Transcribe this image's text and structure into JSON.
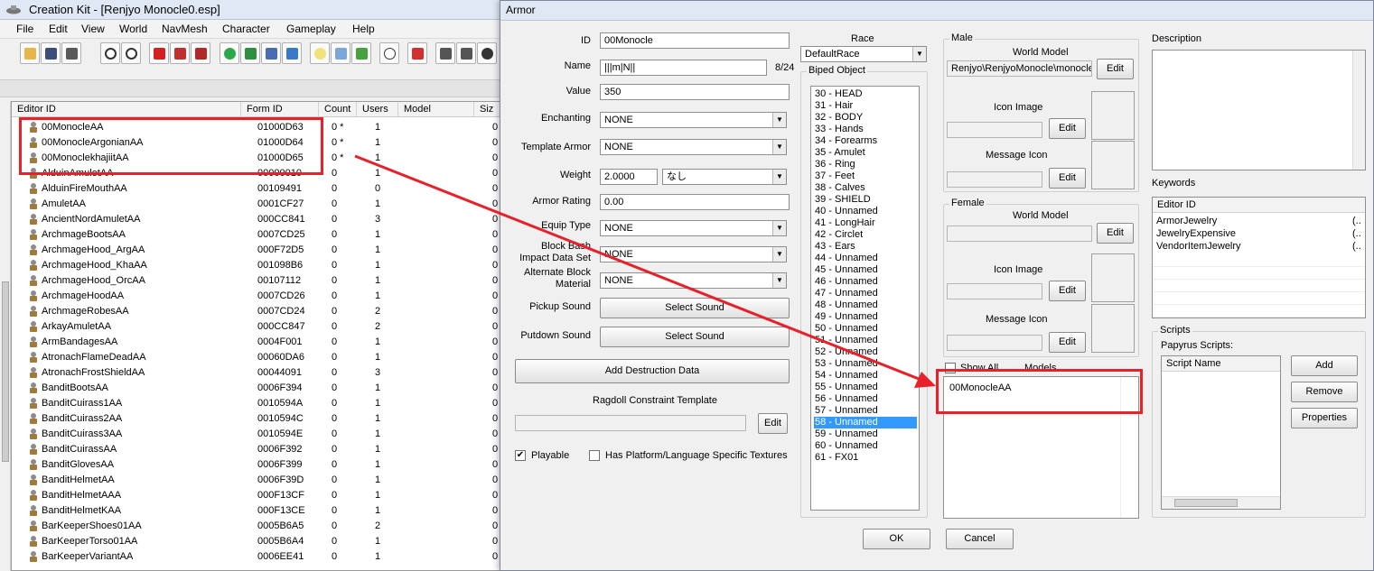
{
  "main_window": {
    "title": "Creation Kit - [Renjyo Monocle0.esp]",
    "menu": [
      "File",
      "Edit",
      "View",
      "World",
      "NavMesh",
      "Character",
      "Gameplay",
      "Help"
    ],
    "toolbar_icons": [
      "open-icon",
      "save-icon",
      "save-all-icon",
      "undo-icon",
      "redo-icon",
      "render-icon",
      "terrain-icon",
      "navmesh-icon",
      "world-icon",
      "landscape-icon",
      "havok-icon",
      "fx-icon",
      "light-icon",
      "sky-icon",
      "grass-icon",
      "dialogue-icon",
      "markers-icon",
      "ref-icon",
      "ref2-icon",
      "mode-icon",
      "collision-icon"
    ]
  },
  "object_list": {
    "columns": [
      "Editor ID",
      "Form ID",
      "Count",
      "Users",
      "Model",
      "Siz"
    ],
    "rows": [
      {
        "id": "00MonocleAA",
        "form": "01000D63",
        "count": "0 *",
        "users": "1",
        "size": "0"
      },
      {
        "id": "00MonocleArgonianAA",
        "form": "01000D64",
        "count": "0 *",
        "users": "1",
        "size": "0"
      },
      {
        "id": "00MonoclekhajiitAA",
        "form": "01000D65",
        "count": "0 *",
        "users": "1",
        "size": "0"
      },
      {
        "id": "AlduinAmuletAA",
        "form": "00000010",
        "count": "0",
        "users": "1",
        "size": "0"
      },
      {
        "id": "AlduinFireMouthAA",
        "form": "00109491",
        "count": "0",
        "users": "0",
        "size": "0"
      },
      {
        "id": "AmuletAA",
        "form": "0001CF27",
        "count": "0",
        "users": "1",
        "size": "0"
      },
      {
        "id": "AncientNordAmuletAA",
        "form": "000CC841",
        "count": "0",
        "users": "3",
        "size": "0"
      },
      {
        "id": "ArchmageBootsAA",
        "form": "0007CD25",
        "count": "0",
        "users": "1",
        "size": "0"
      },
      {
        "id": "ArchmageHood_ArgAA",
        "form": "000F72D5",
        "count": "0",
        "users": "1",
        "size": "0"
      },
      {
        "id": "ArchmageHood_KhaAA",
        "form": "001098B6",
        "count": "0",
        "users": "1",
        "size": "0"
      },
      {
        "id": "ArchmageHood_OrcAA",
        "form": "00107112",
        "count": "0",
        "users": "1",
        "size": "0"
      },
      {
        "id": "ArchmageHoodAA",
        "form": "0007CD26",
        "count": "0",
        "users": "1",
        "size": "0"
      },
      {
        "id": "ArchmageRobesAA",
        "form": "0007CD24",
        "count": "0",
        "users": "2",
        "size": "0"
      },
      {
        "id": "ArkayAmuletAA",
        "form": "000CC847",
        "count": "0",
        "users": "2",
        "size": "0"
      },
      {
        "id": "ArmBandagesAA",
        "form": "0004F001",
        "count": "0",
        "users": "1",
        "size": "0"
      },
      {
        "id": "AtronachFlameDeadAA",
        "form": "00060DA6",
        "count": "0",
        "users": "1",
        "size": "0"
      },
      {
        "id": "AtronachFrostShieldAA",
        "form": "00044091",
        "count": "0",
        "users": "3",
        "size": "0"
      },
      {
        "id": "BanditBootsAA",
        "form": "0006F394",
        "count": "0",
        "users": "1",
        "size": "0"
      },
      {
        "id": "BanditCuirass1AA",
        "form": "0010594A",
        "count": "0",
        "users": "1",
        "size": "0"
      },
      {
        "id": "BanditCuirass2AA",
        "form": "0010594C",
        "count": "0",
        "users": "1",
        "size": "0"
      },
      {
        "id": "BanditCuirass3AA",
        "form": "0010594E",
        "count": "0",
        "users": "1",
        "size": "0"
      },
      {
        "id": "BanditCuirassAA",
        "form": "0006F392",
        "count": "0",
        "users": "1",
        "size": "0"
      },
      {
        "id": "BanditGlovesAA",
        "form": "0006F399",
        "count": "0",
        "users": "1",
        "size": "0"
      },
      {
        "id": "BanditHelmetAA",
        "form": "0006F39D",
        "count": "0",
        "users": "1",
        "size": "0"
      },
      {
        "id": "BanditHelmetAAA",
        "form": "000F13CF",
        "count": "0",
        "users": "1",
        "size": "0"
      },
      {
        "id": "BanditHelmetKAA",
        "form": "000F13CE",
        "count": "0",
        "users": "1",
        "size": "0"
      },
      {
        "id": "BarKeeperShoes01AA",
        "form": "0005B6A5",
        "count": "0",
        "users": "2",
        "size": "0"
      },
      {
        "id": "BarKeeperTorso01AA",
        "form": "0005B6A4",
        "count": "0",
        "users": "1",
        "size": "0"
      },
      {
        "id": "BarKeeperVariantAA",
        "form": "0006EE41",
        "count": "0",
        "users": "1",
        "size": "0"
      }
    ]
  },
  "armor": {
    "title": "Armor",
    "id_label": "ID",
    "id_value": "00Monocle",
    "name_label": "Name",
    "name_value": "|||m|N||",
    "name_count": "8/24",
    "value_label": "Value",
    "value_value": "350",
    "enchanting_label": "Enchanting",
    "enchanting_value": "NONE",
    "template_label": "Template Armor",
    "template_value": "NONE",
    "weight_label": "Weight",
    "weight_value": "2.0000",
    "weight_unit": "なし",
    "rating_label": "Armor Rating",
    "rating_value": "0.00",
    "equip_label": "Equip Type",
    "equip_value": "NONE",
    "impact_label_1": "Block Bash",
    "impact_label_2": "Impact Data Set",
    "impact_value": "NONE",
    "altblock_label_1": "Alternate Block",
    "altblock_label_2": "Material",
    "altblock_value": "NONE",
    "pickup_label": "Pickup Sound",
    "pickup_button": "Select Sound",
    "putdown_label": "Putdown Sound",
    "putdown_button": "Select Sound",
    "destruction_button": "Add Destruction Data",
    "ragdoll_label": "Ragdoll Constraint Template",
    "ragdoll_edit": "Edit",
    "playable_label": "Playable",
    "playable_checked": "✔",
    "platform_label": "Has Platform/Language Specific Textures",
    "race_label": "Race",
    "race_value": "DefaultRace",
    "biped_label": "Biped Object",
    "biped_items": [
      "30 - HEAD",
      "31 - Hair",
      "32 - BODY",
      "33 - Hands",
      "34 - Forearms",
      "35 - Amulet",
      "36 - Ring",
      "37 - Feet",
      "38 - Calves",
      "39 - SHIELD",
      "40 - Unnamed",
      "41 - LongHair",
      "42 - Circlet",
      "43 - Ears",
      "44 - Unnamed",
      "45 - Unnamed",
      "46 - Unnamed",
      "47 - Unnamed",
      "48 - Unnamed",
      "49 - Unnamed",
      "50 - Unnamed",
      "51 - Unnamed",
      "52 - Unnamed",
      "53 - Unnamed",
      "54 - Unnamed",
      "55 - Unnamed",
      "56 - Unnamed",
      "57 - Unnamed",
      "58 - Unnamed",
      "59 - Unnamed",
      "60 - Unnamed",
      "61 - FX01"
    ],
    "biped_selected": "58 - Unnamed",
    "male_label": "Male",
    "female_label": "Female",
    "world_model_label": "World Model",
    "male_world_model": "Renjyo\\RenjyoMonocle\\monocle",
    "icon_image_label": "Icon Image",
    "message_icon_label": "Message Icon",
    "edit_label": "Edit",
    "show_all_label": "Show All",
    "models_label": "Models",
    "models": [
      "00MonocleAA"
    ],
    "description_label": "Description",
    "keywords_label": "Keywords",
    "keywords_col": "Editor ID",
    "keywords": [
      "ArmorJewelry",
      "JewelryExpensive",
      "VendorItemJewelry"
    ],
    "keyword_suffix": "(..",
    "scripts_label": "Scripts",
    "papyrus_label": "Papyrus Scripts:",
    "script_col": "Script Name",
    "add_button": "Add",
    "remove_button": "Remove",
    "properties_button": "Properties",
    "ok_button": "OK",
    "cancel_button": "Cancel"
  },
  "annotation_color": "#e8202a"
}
